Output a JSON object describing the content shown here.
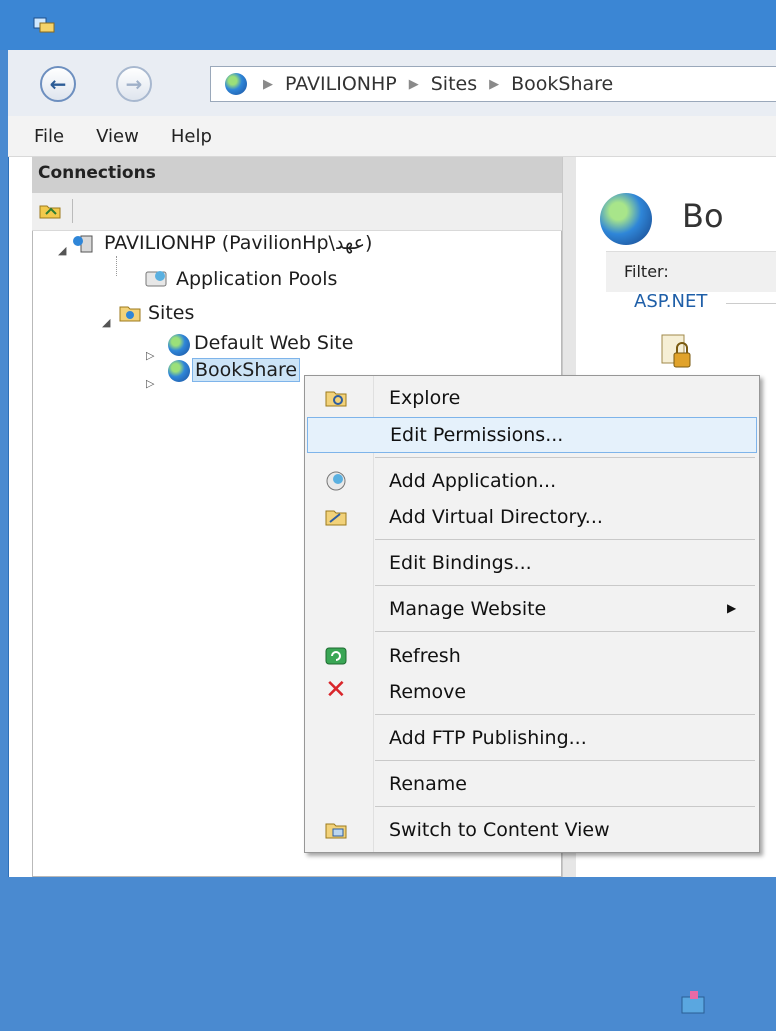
{
  "window": {
    "app_icon": "iis-manager-icon"
  },
  "nav": {
    "back_icon": "back-arrow-icon",
    "forward_icon": "forward-arrow-icon"
  },
  "address": {
    "breadcrumb": [
      "PAVILIONHP",
      "Sites",
      "BookShare"
    ]
  },
  "menu": {
    "file": "File",
    "view": "View",
    "help": "Help"
  },
  "connections": {
    "title": "Connections",
    "tree": {
      "server": "PAVILIONHP (PavilionHp\\عهد)",
      "app_pools": "Application Pools",
      "sites": "Sites",
      "default_site": "Default Web Site",
      "bookshare": "BookShare"
    }
  },
  "right": {
    "title": "Bo",
    "filter_label": "Filter:",
    "group_label": "ASP.NET"
  },
  "context_menu": {
    "explore": "Explore",
    "edit_permissions": "Edit Permissions...",
    "add_application": "Add Application...",
    "add_virtual_directory": "Add Virtual Directory...",
    "edit_bindings": "Edit Bindings...",
    "manage_website": "Manage Website",
    "refresh": "Refresh",
    "remove": "Remove",
    "add_ftp_publishing": "Add FTP Publishing...",
    "rename": "Rename",
    "switch_content_view": "Switch to Content View"
  }
}
